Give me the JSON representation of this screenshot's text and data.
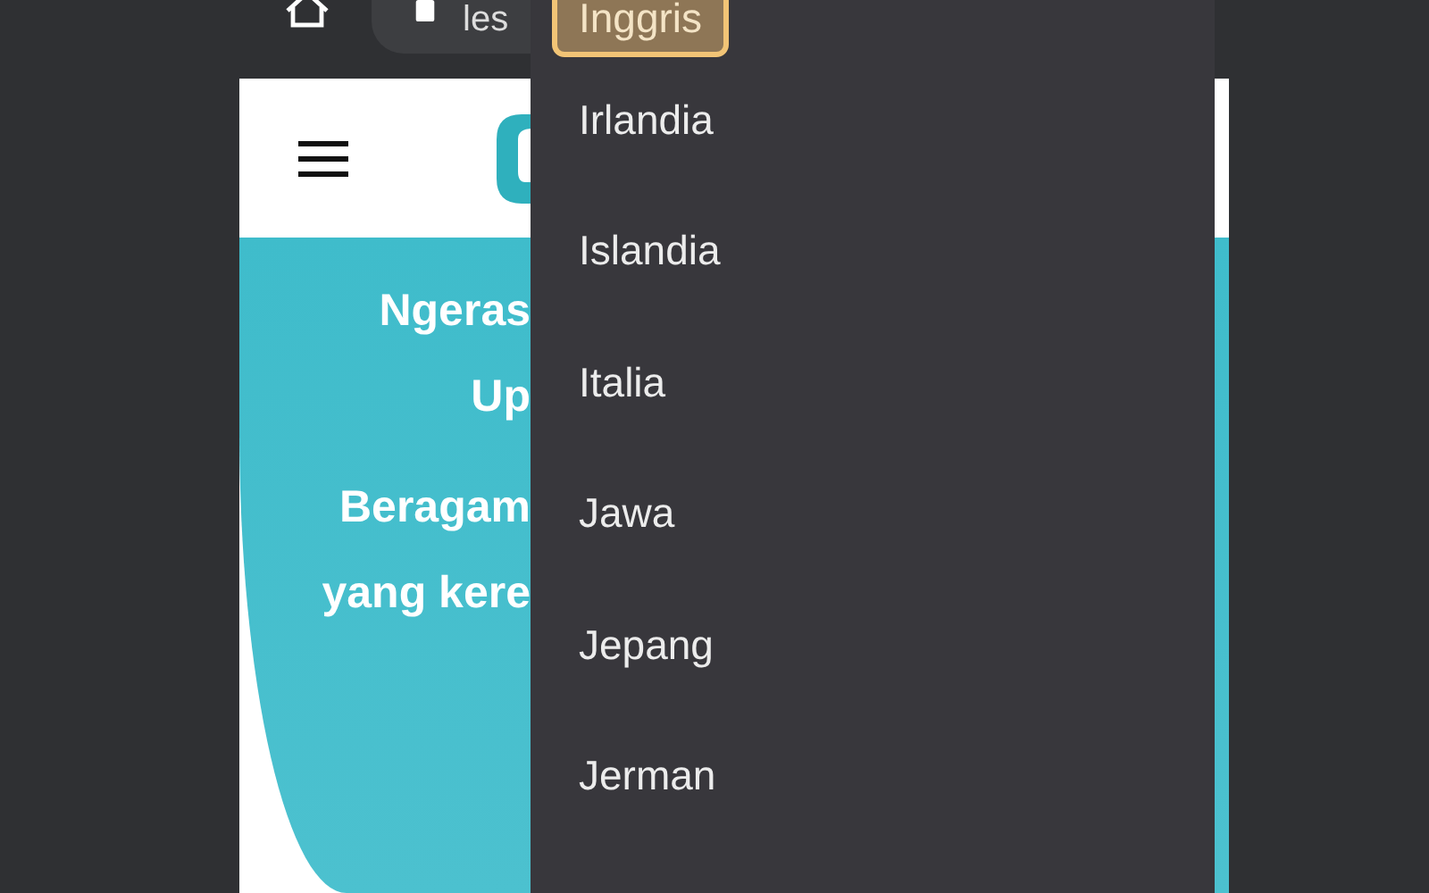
{
  "browser": {
    "url": "les"
  },
  "page": {
    "headline": [
      "Ngeras",
      "Up"
    ],
    "subline": [
      "Beragam",
      "yang kere"
    ]
  },
  "dropdown": {
    "options": [
      {
        "label": "Inggris",
        "selected": true
      },
      {
        "label": "Irlandia",
        "selected": false
      },
      {
        "label": "Islandia",
        "selected": false
      },
      {
        "label": "Italia",
        "selected": false
      },
      {
        "label": "Jawa",
        "selected": false
      },
      {
        "label": "Jepang",
        "selected": false
      },
      {
        "label": "Jerman",
        "selected": false
      }
    ]
  }
}
